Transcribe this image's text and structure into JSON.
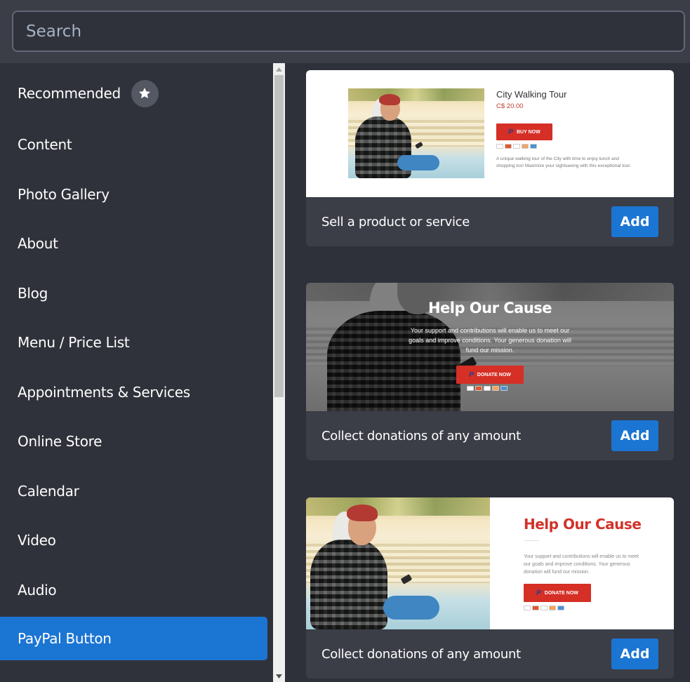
{
  "search": {
    "placeholder": "Search",
    "value": ""
  },
  "sidebar": {
    "items": [
      {
        "label": "Recommended",
        "icon": "star-icon",
        "active": false
      },
      {
        "label": "Content",
        "active": false
      },
      {
        "label": "Photo Gallery",
        "active": false
      },
      {
        "label": "About",
        "active": false
      },
      {
        "label": "Blog",
        "active": false
      },
      {
        "label": "Menu / Price List",
        "active": false
      },
      {
        "label": "Appointments & Services",
        "active": false
      },
      {
        "label": "Online Store",
        "active": false
      },
      {
        "label": "Calendar",
        "active": false
      },
      {
        "label": "Video",
        "active": false
      },
      {
        "label": "Audio",
        "active": false
      },
      {
        "label": "PayPal Button",
        "active": true
      }
    ]
  },
  "cards": [
    {
      "description": "Sell a product or service",
      "add_label": "Add",
      "preview": {
        "title": "City Walking Tour",
        "price": "C$ 20.00",
        "button": "BUY NOW",
        "text": "A unique walking tour of the City with time to enjoy lunch and shopping too! Maximize your sightseeing with this exceptional tour."
      }
    },
    {
      "description": "Collect donations of any amount",
      "add_label": "Add",
      "preview": {
        "title": "Help Our Cause",
        "text": "Your support and contributions will enable us to meet our goals and improve conditions. Your generous donation will fund our mission.",
        "button": "DONATE NOW"
      }
    },
    {
      "description": "Collect donations of any amount",
      "add_label": "Add",
      "preview": {
        "title": "Help Our Cause",
        "text": "Your support and contributions will enable us to meet our goals and improve conditions. Your generous donation will fund our mission.",
        "button": "DONATE NOW"
      }
    }
  ],
  "payment_icons": [
    "paypal",
    "mastercard",
    "visa",
    "discover",
    "amex"
  ],
  "paypal_glyph": "P",
  "colors": {
    "accent": "#1b75d3",
    "paypal_red": "#d52f26",
    "sidebar_bg": "#30323b",
    "card_footer_bg": "#3b3d47"
  }
}
